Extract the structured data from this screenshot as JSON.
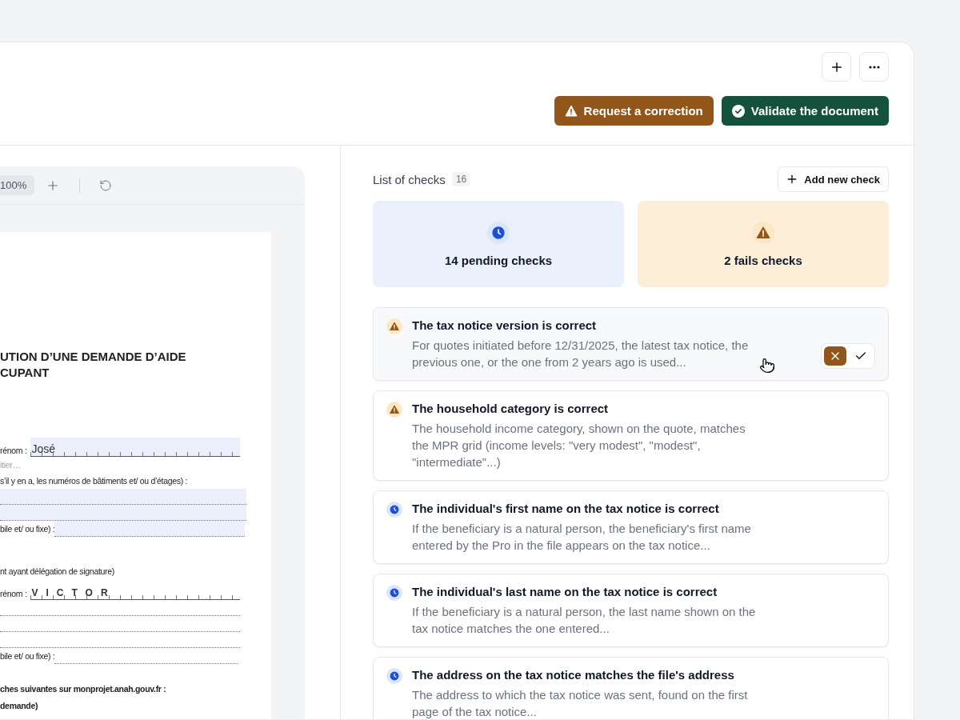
{
  "header": {
    "icon_buttons": [
      {
        "kind": "add"
      },
      {
        "kind": "more"
      }
    ],
    "actions": [
      {
        "kind": "correction",
        "label": "Request a correction"
      },
      {
        "kind": "validate",
        "label": "Validate the document"
      }
    ]
  },
  "viewer": {
    "zoom": "100%",
    "document": {
      "title_lines": [
        "UTION D’UNE DEMANDE D’AIDE",
        "CUPANT"
      ],
      "lines": [
        {
          "kind": "boxes",
          "label": "rénom :",
          "value": "José",
          "highlighted": true
        },
        {
          "kind": "hint",
          "text": "itier…"
        },
        {
          "kind": "text",
          "text": "s’il y en a, les numéros de bâtiments et/ ou d’étages) :"
        },
        {
          "kind": "dotted",
          "highlighted": true
        },
        {
          "kind": "dotted",
          "highlighted": true
        },
        {
          "kind": "label_dotted",
          "label": "bile et/ ou fixe) :",
          "highlighted": true
        },
        {
          "kind": "section",
          "text": "nt ayant délégation de signature)"
        },
        {
          "kind": "boxes",
          "label": "rénom :",
          "value": "VICTOR",
          "highlighted": false
        },
        {
          "kind": "dotted",
          "highlighted": false
        },
        {
          "kind": "dotted",
          "highlighted": false
        },
        {
          "kind": "dotted",
          "highlighted": false
        },
        {
          "kind": "label_dotted",
          "label": "bile et/ ou fixe) :",
          "highlighted": false
        },
        {
          "kind": "bold",
          "text": "ches suivantes sur monprojet.anah.gouv.fr :"
        },
        {
          "kind": "bold",
          "text": "demande)"
        }
      ]
    }
  },
  "checks": {
    "title": "List of checks",
    "count": "16",
    "add_button": "Add new check",
    "summary": [
      {
        "kind": "pending",
        "label": "14 pending checks"
      },
      {
        "kind": "fail",
        "label": "2 fails checks"
      }
    ],
    "items": [
      {
        "kind": "fail",
        "title": "The tax notice version is correct",
        "description": "For quotes initiated before 12/31/2025, the latest tax notice, the previous one, or the one from 2 years ago is used...",
        "highlighted": true,
        "decision": [
          {
            "kind": "reject",
            "selected": true
          },
          {
            "kind": "accept",
            "selected": false
          }
        ]
      },
      {
        "kind": "fail",
        "title": "The household category is correct",
        "description": "The household income category, shown on the quote, matches the MPR grid (income levels: \"very modest\", \"modest\", \"intermediate\"...)",
        "highlighted": false
      },
      {
        "kind": "pending",
        "title": "The individual's first name on the tax notice is correct",
        "description": "If the beneficiary is a natural person, the beneficiary's first name entered by the Pro in the file appears on the tax notice...",
        "highlighted": false
      },
      {
        "kind": "pending",
        "title": "The individual's last name on the tax notice is correct",
        "description": "If the beneficiary is a natural person, the last name shown on the tax notice matches the one entered...",
        "highlighted": false
      },
      {
        "kind": "pending",
        "title": "The address on the tax notice matches the file's address",
        "description": "The address to which the tax notice was sent, found on the first page of the tax notice...",
        "highlighted": false
      }
    ]
  }
}
